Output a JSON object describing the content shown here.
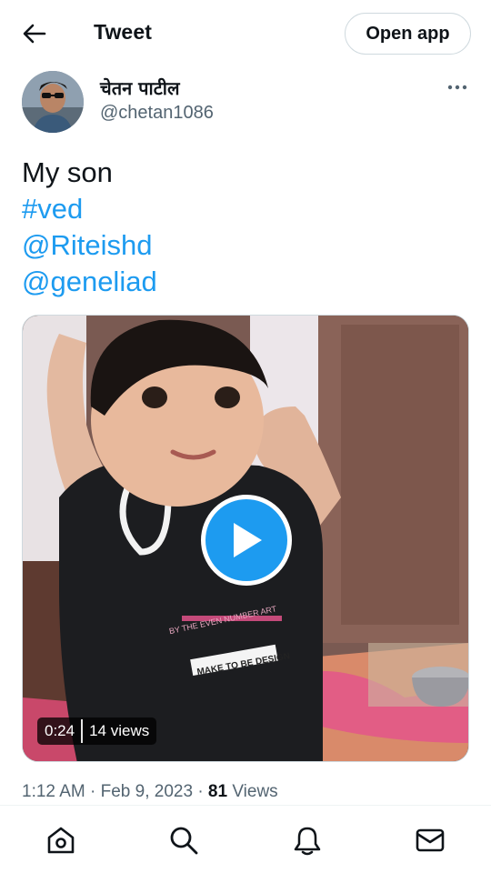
{
  "header": {
    "title": "Tweet",
    "back_icon": "arrow-left-icon",
    "open_app_label": "Open app"
  },
  "author": {
    "display_name": "चेतन पाटील",
    "handle": "@chetan1086",
    "more_icon": "more-horizontal-icon"
  },
  "tweet": {
    "lines": [
      {
        "text": "My son",
        "is_link": false
      },
      {
        "text": "#ved",
        "is_link": true
      },
      {
        "text": "@Riteishd",
        "is_link": true
      },
      {
        "text": "@geneliad",
        "is_link": true
      }
    ]
  },
  "media": {
    "duration": "0:24",
    "views": "14 views",
    "play_icon": "play-icon",
    "shirt_text_1": "BY THE EVEN NUMBER ART",
    "shirt_text_2": "MAKE TO BE DESIGN"
  },
  "meta": {
    "time": "1:12 AM",
    "separator": "·",
    "date": "Feb 9, 2023",
    "view_count": "81",
    "views_label": "Views"
  },
  "nav": {
    "items": [
      "home-icon",
      "search-icon",
      "notifications-bell-icon",
      "messages-mail-icon"
    ]
  },
  "colors": {
    "accent": "#1d9bf0",
    "text_primary": "#0f1419",
    "text_secondary": "#536471",
    "border": "#cfd9de"
  }
}
